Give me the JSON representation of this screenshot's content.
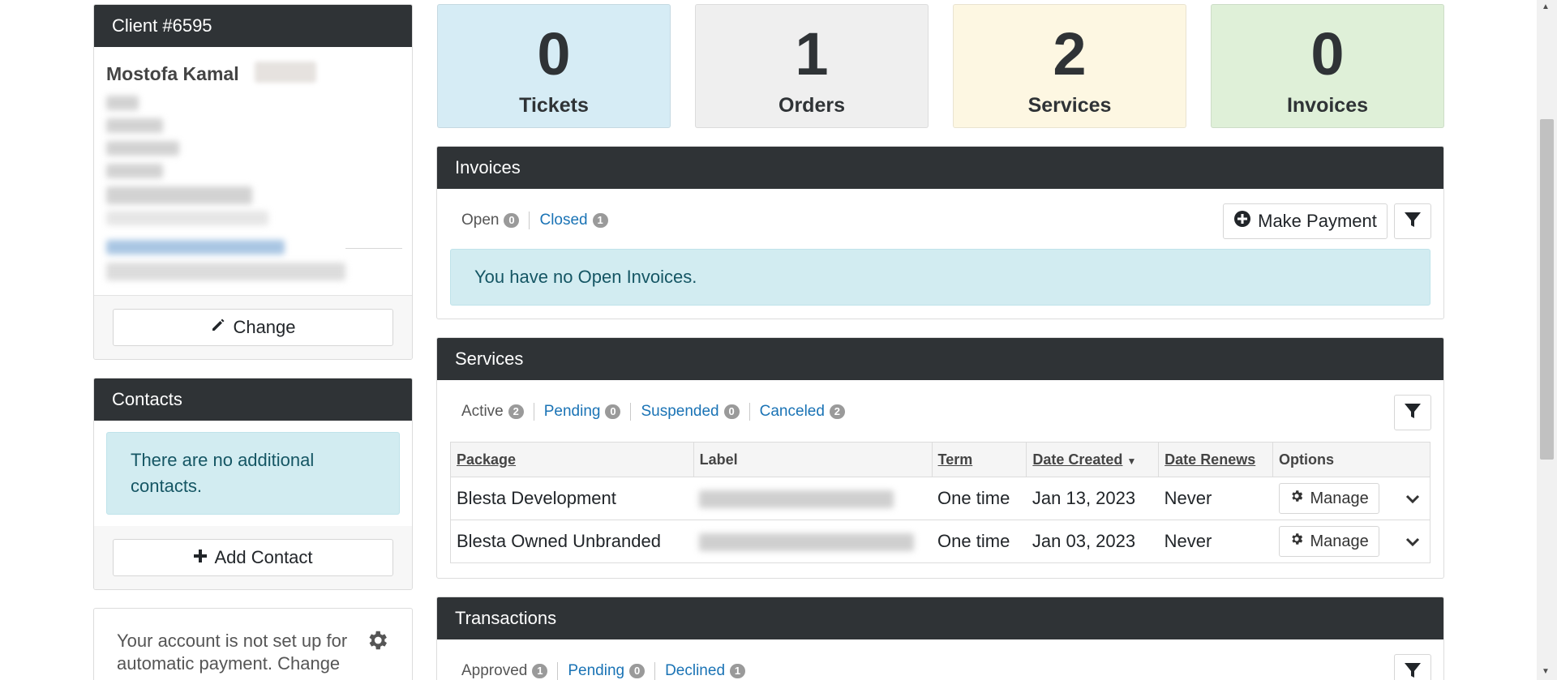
{
  "client": {
    "header": "Client #6595",
    "name": "Mostofa Kamal",
    "change_label": "Change"
  },
  "contacts": {
    "header": "Contacts",
    "empty_message": "There are no additional contacts.",
    "add_label": "Add Contact"
  },
  "autopay": {
    "text": "Your account is not set up for automatic payment. Change"
  },
  "stats": [
    {
      "value": "0",
      "label": "Tickets",
      "color": "#d6ecf5"
    },
    {
      "value": "1",
      "label": "Orders",
      "color": "#efefef"
    },
    {
      "value": "2",
      "label": "Services",
      "color": "#fdf7e2"
    },
    {
      "value": "0",
      "label": "Invoices",
      "color": "#dff0d8"
    }
  ],
  "invoices": {
    "title": "Invoices",
    "filters": [
      {
        "label": "Open",
        "count": "0"
      },
      {
        "label": "Closed",
        "count": "1"
      }
    ],
    "make_payment_label": "Make Payment",
    "empty_message": "You have no Open Invoices."
  },
  "services": {
    "title": "Services",
    "filters": [
      {
        "label": "Active",
        "count": "2"
      },
      {
        "label": "Pending",
        "count": "0"
      },
      {
        "label": "Suspended",
        "count": "0"
      },
      {
        "label": "Canceled",
        "count": "2"
      }
    ],
    "columns": [
      "Package",
      "Label",
      "Term",
      "Date Created",
      "Date Renews",
      "Options"
    ],
    "rows": [
      {
        "package": "Blesta Development",
        "term": "One time",
        "created": "Jan 13, 2023",
        "renews": "Never",
        "manage": "Manage"
      },
      {
        "package": "Blesta Owned Unbranded",
        "term": "One time",
        "created": "Jan 03, 2023",
        "renews": "Never",
        "manage": "Manage"
      }
    ]
  },
  "transactions": {
    "title": "Transactions",
    "filters": [
      {
        "label": "Approved",
        "count": "1"
      },
      {
        "label": "Pending",
        "count": "0"
      },
      {
        "label": "Declined",
        "count": "1"
      }
    ]
  }
}
